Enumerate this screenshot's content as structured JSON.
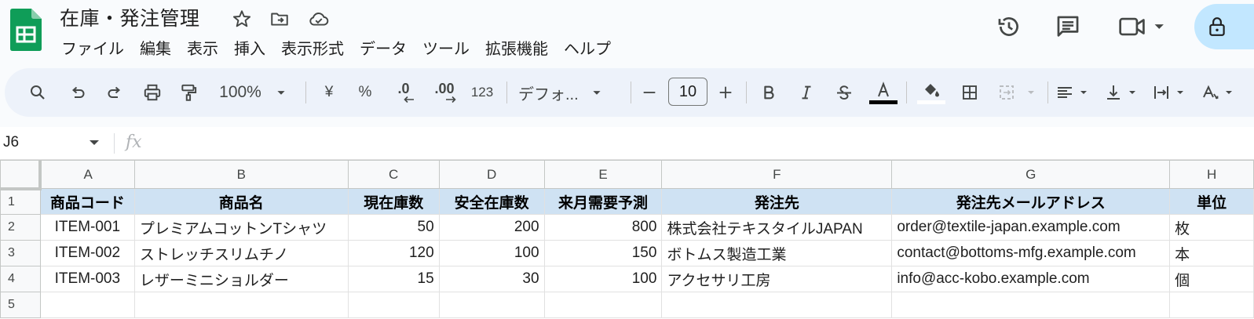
{
  "doc": {
    "title": "在庫・発注管理"
  },
  "menu": [
    "ファイル",
    "編集",
    "表示",
    "挿入",
    "表示形式",
    "データ",
    "ツール",
    "拡張機能",
    "ヘルプ"
  ],
  "toolbar": {
    "zoom": "100%",
    "currency": "¥",
    "percent": "%",
    "decrease_decimal": ".0",
    "increase_decimal": ".00",
    "more_formats": "123",
    "font": "デフォ...",
    "font_size": "10"
  },
  "formula_bar": {
    "cell_ref": "J6",
    "fx": "fx"
  },
  "sheet": {
    "columns": [
      "A",
      "B",
      "C",
      "D",
      "E",
      "F",
      "G",
      "H"
    ],
    "row_numbers": [
      "1",
      "2",
      "3",
      "4",
      "5"
    ],
    "header": [
      "商品コード",
      "商品名",
      "現在庫数",
      "安全在庫数",
      "来月需要予測",
      "発注先",
      "発注先メールアドレス",
      "単位"
    ],
    "rows": [
      [
        "ITEM-001",
        "プレミアムコットンTシャツ",
        "50",
        "200",
        "800",
        "株式会社テキスタイルJAPAN",
        "order@textile-japan.example.com",
        "枚"
      ],
      [
        "ITEM-002",
        "ストレッチスリムチノ",
        "120",
        "100",
        "150",
        "ボトムス製造工業",
        "contact@bottoms-mfg.example.com",
        "本"
      ],
      [
        "ITEM-003",
        "レザーミニショルダー",
        "15",
        "30",
        "100",
        "アクセサリ工房",
        "info@acc-kobo.example.com",
        "個"
      ]
    ]
  },
  "colors": {
    "header_fill": "#cfe2f3",
    "sheets_green": "#0f9d58",
    "share_bg": "#c2e7ff"
  }
}
